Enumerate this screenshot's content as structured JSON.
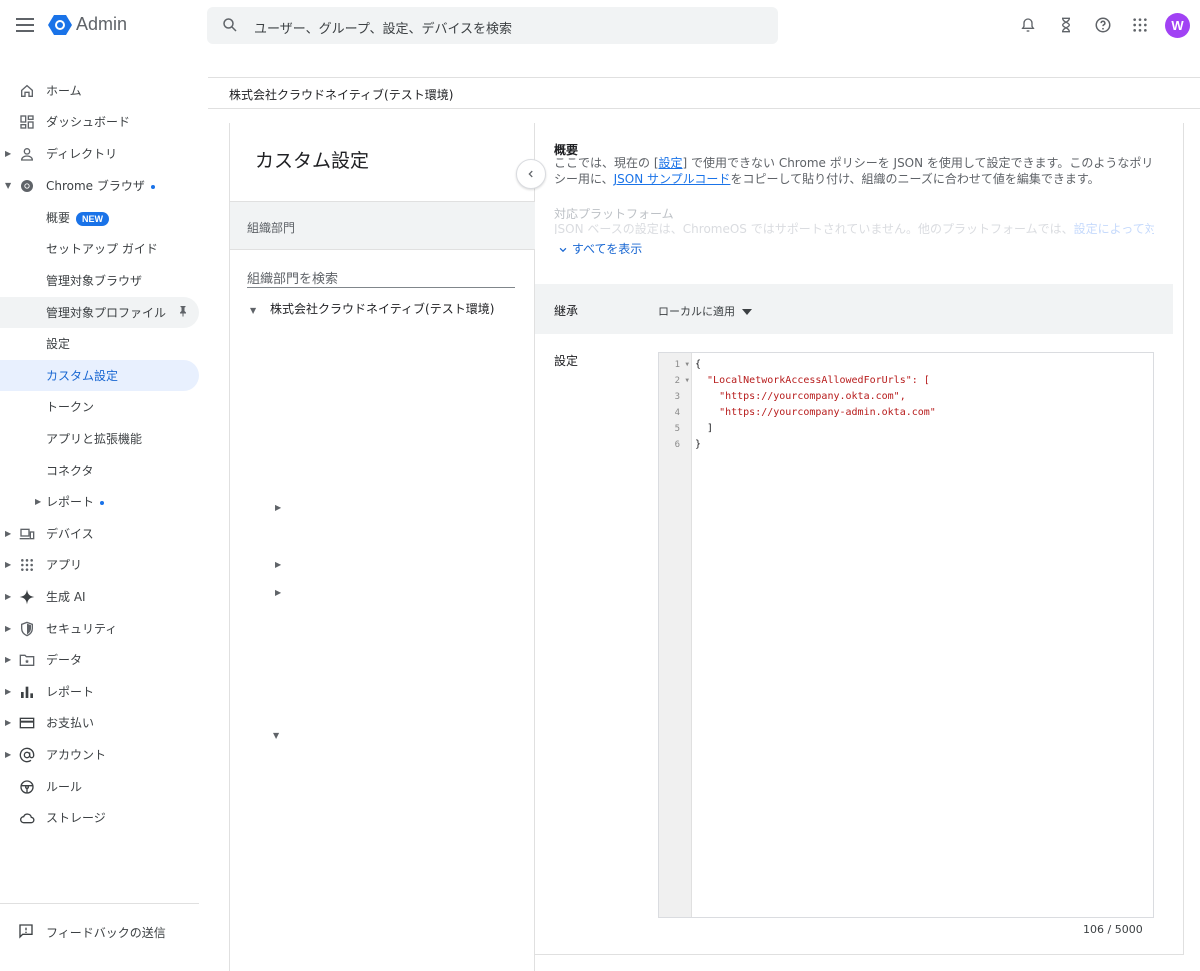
{
  "app": {
    "title": "Admin"
  },
  "search": {
    "placeholder": "ユーザー、グループ、設定、デバイスを検索"
  },
  "account": {
    "avatar_letter": "W",
    "avatar_color": "#a142f4"
  },
  "sidebar": {
    "items": [
      {
        "label": "ホーム",
        "icon": "home-icon"
      },
      {
        "label": "ダッシュボード",
        "icon": "dashboard-icon"
      },
      {
        "label": "ディレクトリ",
        "icon": "person-icon"
      },
      {
        "label": "Chrome ブラウザ",
        "icon": "chrome-icon"
      },
      {
        "label": "概要",
        "badge": "NEW"
      },
      {
        "label": "セットアップ ガイド"
      },
      {
        "label": "管理対象ブラウザ"
      },
      {
        "label": "管理対象プロファイル",
        "icon": "pin-icon"
      },
      {
        "label": "設定"
      },
      {
        "label": "カスタム設定"
      },
      {
        "label": "トークン"
      },
      {
        "label": "アプリと拡張機能"
      },
      {
        "label": "コネクタ"
      },
      {
        "label": "レポート"
      },
      {
        "label": "デバイス",
        "icon": "devices-icon"
      },
      {
        "label": "アプリ",
        "icon": "apps-grid-icon"
      },
      {
        "label": "生成 AI",
        "icon": "sparkle-icon"
      },
      {
        "label": "セキュリティ",
        "icon": "shield-icon"
      },
      {
        "label": "データ",
        "icon": "data-folder-icon"
      },
      {
        "label": "レポート",
        "icon": "bar-chart-icon"
      },
      {
        "label": "お支払い",
        "icon": "credit-card-icon"
      },
      {
        "label": "アカウント",
        "icon": "at-sign-icon"
      },
      {
        "label": "ルール",
        "icon": "steering-wheel-icon"
      },
      {
        "label": "ストレージ",
        "icon": "cloud-icon"
      }
    ],
    "feedback": "フィードバックの送信"
  },
  "breadcrumb": "株式会社クラウドネイティブ(テスト環境)",
  "org_panel": {
    "title": "カスタム設定",
    "header": "組織部門",
    "search_placeholder": "組織部門を検索",
    "root_unit": "株式会社クラウドネイティブ(テスト環境)"
  },
  "detail": {
    "overview_title": "概要",
    "overview_text_1": "ここでは、現在の [",
    "overview_link_settings": "設定",
    "overview_text_2": "] で使用できない Chrome ポリシーを JSON を使用して設定できます。このようなポリシー用に、",
    "overview_link_json": "JSON サンプルコード",
    "overview_text_3": "をコピーして貼り付け、組織のニーズに合わせて値を編集できます。",
    "platform_title": "対応プラットフォーム",
    "platform_text": "JSON ベースの設定は、ChromeOS ではサポートされていません。他のプラットフォームでは、",
    "platform_link": "設定によって対応",
    "show_all": "すべてを表示",
    "inherit_label": "継承",
    "inherit_value": "ローカルに適用",
    "setting_label": "設定",
    "code_lines": [
      "{",
      "  \"LocalNetworkAccessAllowedForUrls\": [",
      "    \"https://yourcompany.okta.com\",",
      "    \"https://yourcompany-admin.okta.com\"",
      "  ]",
      "}"
    ],
    "line_numbers": [
      "1",
      "2",
      "3",
      "4",
      "5",
      "6"
    ],
    "char_counter": "106 / 5000"
  }
}
